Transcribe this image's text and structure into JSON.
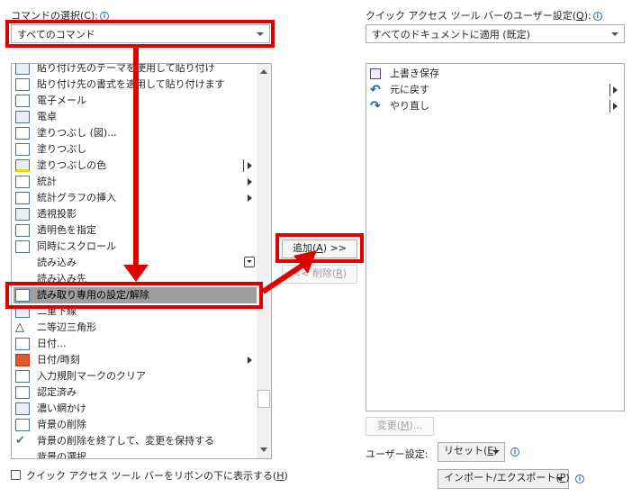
{
  "left": {
    "label": "コマンドの選択(",
    "label_key": "C",
    "label_end": "):",
    "combo_value": "すべてのコマンド",
    "items": [
      {
        "label": "貼り付け先のテーマを使用して貼り付け",
        "icon": "paste-theme-icon"
      },
      {
        "label": "貼り付け先の書式を適用して貼り付けます",
        "icon": "paste-format-icon"
      },
      {
        "label": "電子メール",
        "icon": "email-icon"
      },
      {
        "label": "電卓",
        "icon": "calculator-icon"
      },
      {
        "label": "塗りつぶし (図)...",
        "icon": "picture-fill-icon"
      },
      {
        "label": "塗りつぶし",
        "icon": "fill-icon"
      },
      {
        "label": "塗りつぶしの色",
        "icon": "fill-color-icon"
      },
      {
        "label": "統計",
        "icon": "statistics-icon"
      },
      {
        "label": "統計グラフの挿入",
        "icon": "insert-chart-icon"
      },
      {
        "label": "透視投影",
        "icon": "perspective-icon"
      },
      {
        "label": "透明色を指定",
        "icon": "transparent-color-icon"
      },
      {
        "label": "同時にスクロール",
        "icon": "sync-scroll-icon"
      },
      {
        "label": "読み込み",
        "icon": ""
      },
      {
        "label": "読み込み先",
        "icon": ""
      },
      {
        "label": "読み取り専用の設定/解除",
        "icon": "readonly-toggle-icon"
      },
      {
        "label": "二重下線",
        "icon": "double-underline-icon"
      },
      {
        "label": "二等辺三角形",
        "icon": "isosceles-triangle-icon"
      },
      {
        "label": "日付...",
        "icon": "date-icon"
      },
      {
        "label": "日付/時刻",
        "icon": "datetime-icon"
      },
      {
        "label": "入力規則マークのクリア",
        "icon": "clear-validation-icon"
      },
      {
        "label": "認定済み",
        "icon": "certified-icon"
      },
      {
        "label": "濃い網かけ",
        "icon": "dark-shading-icon"
      },
      {
        "label": "背景の削除",
        "icon": "remove-background-icon"
      },
      {
        "label": "背景の削除を終了して、変更を保持する",
        "icon": "keep-changes-icon"
      },
      {
        "label": "背景の選択",
        "icon": ""
      }
    ],
    "checkbox_label": "クイック アクセス ツール バーをリボンの下に表示する(",
    "checkbox_key": "H",
    "checkbox_end": ")"
  },
  "middle": {
    "add_label": "追加(",
    "add_key": "A",
    "add_end": ") >>",
    "remove_label": "<< 削除(",
    "remove_key": "R",
    "remove_end": ")"
  },
  "right": {
    "label": "クイック アクセス ツール バーのユーザー設定(",
    "label_key": "Q",
    "label_end": "):",
    "combo_value": "すべてのドキュメントに適用 (既定)",
    "items": [
      {
        "label": "上書き保存",
        "icon": "save-icon"
      },
      {
        "label": "元に戻す",
        "icon": "undo-icon"
      },
      {
        "label": "やり直し",
        "icon": "redo-icon"
      }
    ],
    "modify_label": "変更(",
    "modify_key": "M",
    "modify_end": ")...",
    "user_settings_label": "ユーザー設定:",
    "reset_label": "リセット(",
    "reset_key": "E",
    "reset_end": ")",
    "import_export_label": "インポート/エクスポート(",
    "import_export_key": "P",
    "import_export_end": ")"
  },
  "colors": {
    "highlight_red": "#e00000",
    "selected_row": "#9e9e9e"
  }
}
